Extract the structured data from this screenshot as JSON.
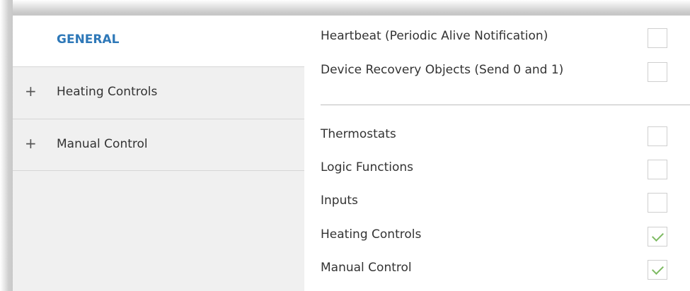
{
  "sidebar": {
    "general_label": "GENERAL",
    "items": [
      {
        "expand_icon": "+",
        "label": "Heating Controls"
      },
      {
        "expand_icon": "+",
        "label": "Manual Control"
      }
    ]
  },
  "main": {
    "options_top": [
      {
        "label": "Heartbeat (Periodic Alive Notification)",
        "checked": false
      },
      {
        "label": "Device Recovery Objects (Send 0 and 1)",
        "checked": false
      }
    ],
    "options_bottom": [
      {
        "label": "Thermostats",
        "checked": false
      },
      {
        "label": "Logic Functions",
        "checked": false
      },
      {
        "label": "Inputs",
        "checked": false
      },
      {
        "label": "Heating Controls",
        "checked": true
      },
      {
        "label": "Manual Control",
        "checked": true
      }
    ]
  },
  "colors": {
    "accent": "#2e78b8",
    "check": "#7dba62",
    "sidebar_bg": "#f0f0f0"
  }
}
